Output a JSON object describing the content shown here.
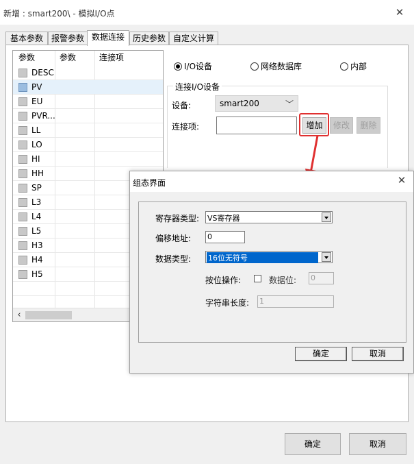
{
  "window": {
    "title": "新增 : smart200\\ - 模拟I/O点"
  },
  "tabs": [
    {
      "label": "基本参数"
    },
    {
      "label": "报警参数"
    },
    {
      "label": "数据连接",
      "active": true
    },
    {
      "label": "历史参数"
    },
    {
      "label": "自定义计算"
    }
  ],
  "grid": {
    "headers": [
      "参数",
      "参数",
      "连接项"
    ],
    "rows": [
      "DESC",
      "PV",
      "EU",
      "PVR...",
      "LL",
      "LO",
      "HI",
      "HH",
      "SP",
      "L3",
      "L4",
      "L5",
      "H3",
      "H4",
      "H5"
    ],
    "selected_row": "PV"
  },
  "source": {
    "options": [
      {
        "label": "I/O设备",
        "checked": true
      },
      {
        "label": "网络数据库",
        "checked": false
      },
      {
        "label": "内部",
        "checked": false
      }
    ]
  },
  "io_group": {
    "title": "连接I/O设备",
    "device_label": "设备:",
    "device_value": "smart200",
    "item_label": "连接项:",
    "item_value": "",
    "add_button": "增加",
    "modify_button": "修改",
    "delete_button": "删除"
  },
  "footer": {
    "ok": "确定",
    "cancel": "取消"
  },
  "dialog": {
    "title": "组态界面",
    "register_type_label": "寄存器类型:",
    "register_type_value": "VS寄存器",
    "offset_label": "偏移地址:",
    "offset_value": "0",
    "data_type_label": "数据类型:",
    "data_type_value": "16位无符号",
    "bit_op_label": "按位操作:",
    "bit_label": "数据位:",
    "bit_value": "0",
    "str_len_label": "字符串长度:",
    "str_len_value": "1",
    "ok": "确定",
    "cancel": "取消"
  },
  "colors": {
    "highlight": "#e03030",
    "selected_row": "#e5f1fb",
    "dropdown_selection": "#0066cc"
  }
}
